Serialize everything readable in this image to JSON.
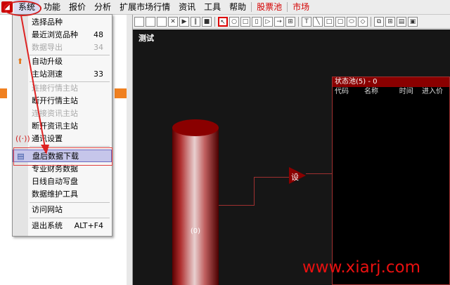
{
  "menubar": {
    "items": [
      {
        "label": "系统"
      },
      {
        "label": "功能"
      },
      {
        "label": "报价"
      },
      {
        "label": "分析"
      },
      {
        "label": "扩展市场行情"
      },
      {
        "label": "资讯"
      },
      {
        "label": "工具"
      },
      {
        "label": "帮助"
      },
      {
        "label": "股票池"
      },
      {
        "label": "市场"
      }
    ]
  },
  "dropdown": {
    "items": [
      {
        "label": "选择品种",
        "shortcut": ""
      },
      {
        "label": "最近浏览品种",
        "shortcut": "48"
      },
      {
        "label": "数据导出",
        "shortcut": "34"
      },
      {
        "label": "自动升级",
        "shortcut": ""
      },
      {
        "label": "主站测速",
        "shortcut": "33"
      },
      {
        "label": "连接行情主站",
        "shortcut": ""
      },
      {
        "label": "断开行情主站",
        "shortcut": ""
      },
      {
        "label": "连接资讯主站",
        "shortcut": ""
      },
      {
        "label": "断开资讯主站",
        "shortcut": ""
      },
      {
        "label": "通讯设置",
        "shortcut": ""
      },
      {
        "label": "盘后数据下载",
        "shortcut": ""
      },
      {
        "label": "专业财务数据",
        "shortcut": ""
      },
      {
        "label": "日线自动写盘",
        "shortcut": ""
      },
      {
        "label": "数据维护工具",
        "shortcut": ""
      },
      {
        "label": "访问网站",
        "shortcut": ""
      },
      {
        "label": "退出系统",
        "shortcut": "ALT+F4"
      }
    ]
  },
  "canvas": {
    "title": "测试",
    "cylinder_label": "(0)",
    "trigger_label": "设",
    "pool": {
      "title": "状态池(5) - 0",
      "columns": [
        "代码",
        "名称",
        "时间",
        "进入价"
      ]
    }
  },
  "watermark": "www.xiarj.com",
  "colors": {
    "accent_red": "#d40000",
    "highlight": "#c6c6ea",
    "canvas_bg": "#161616"
  }
}
